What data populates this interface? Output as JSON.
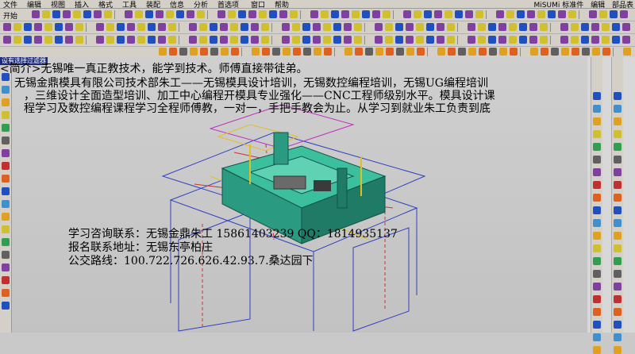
{
  "menubar": {
    "items": [
      "文件",
      "编辑",
      "视图",
      "插入",
      "格式",
      "工具",
      "装配",
      "信息",
      "分析",
      "首选项",
      "窗口",
      "帮助"
    ],
    "right": [
      "MiSUMi 标准件",
      "编辑",
      "部品表"
    ]
  },
  "toolbar": {
    "start_label": "开始"
  },
  "overlay_tag": "设有选择过滤器",
  "ad": {
    "line1": "<简介>无锡唯一真正教技术，能学到技术。师傅直接带徒弟。",
    "line2": "无锡金鼎模具有限公司技术部朱工——无锡模具设计培训，无锡数控编程培训，无锡UG编程培训",
    "line3": "，三维设计全面造型培训、加工中心编程开模具专业强化——CNC工程师级别水平。模具设计课",
    "line4": "程学习及数控编程课程学习全程师傅教，一对一，手把手教会为止。从学习到就业朱工负责到底"
  },
  "contact": {
    "line1": "学习咨询联系：无锡金鼎朱工 15861403239 QQ：1814935137",
    "line2": "报名联系地址：无锡东亭柏庄",
    "line3": "公交路线：100.722.726.626.42.93.7.桑达园下"
  },
  "colors": {
    "mold_green": "#2fa58d",
    "mold_dark": "#1f6f5f",
    "wire_blue": "#3040c0",
    "wire_red": "#d03030",
    "wire_yellow": "#e0c020"
  }
}
